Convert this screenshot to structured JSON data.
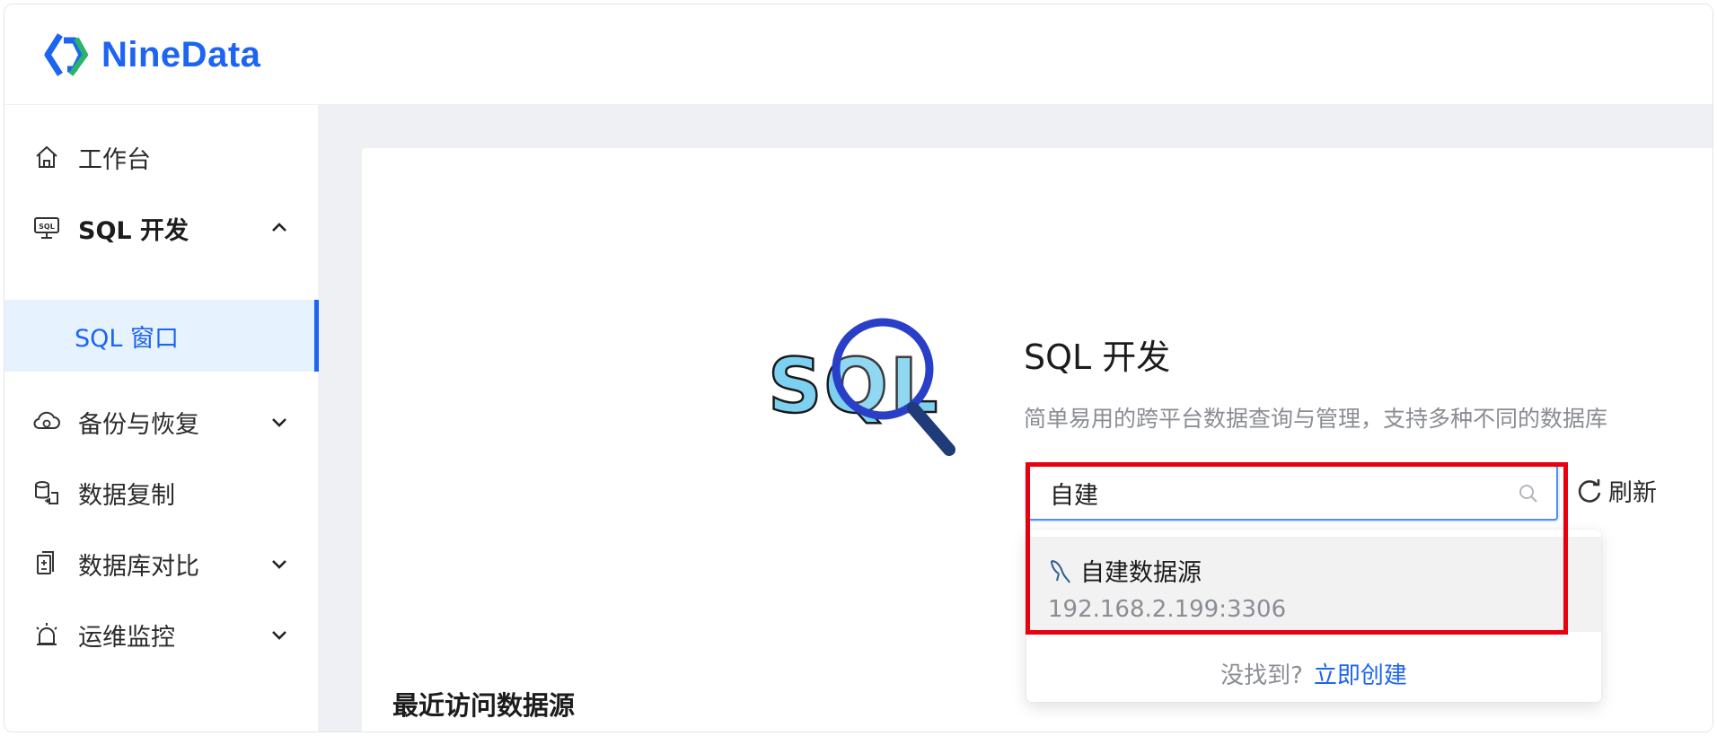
{
  "brand": {
    "name": "NineData",
    "color": "#1d64f2"
  },
  "sidebar": {
    "items": [
      {
        "label": "工作台",
        "icon": "home-icon"
      },
      {
        "label": "SQL 开发",
        "icon": "sql-monitor-icon",
        "expanded": true
      },
      {
        "label": "SQL 窗口",
        "selected": true
      },
      {
        "label": "备份与恢复",
        "icon": "cloud-backup-icon"
      },
      {
        "label": "数据复制",
        "icon": "data-copy-icon"
      },
      {
        "label": "数据库对比",
        "icon": "compare-icon"
      },
      {
        "label": "运维监控",
        "icon": "alarm-icon"
      }
    ]
  },
  "main": {
    "title": "SQL 开发",
    "subtitle": "简单易用的跨平台数据查询与管理，支持多种不同的数据库",
    "search": {
      "value": "自建"
    },
    "refresh_label": "刷新",
    "dropdown": {
      "option": {
        "name": "自建数据源",
        "address": "192.168.2.199:3306",
        "icon": "mysql-icon"
      },
      "not_found": "没找到?",
      "create_link": "立即创建"
    },
    "recent_title": "最近访问数据源"
  },
  "colors": {
    "accent": "#1d64f2",
    "highlight": "#e8000f",
    "selected_bg": "#e6f2fd"
  }
}
